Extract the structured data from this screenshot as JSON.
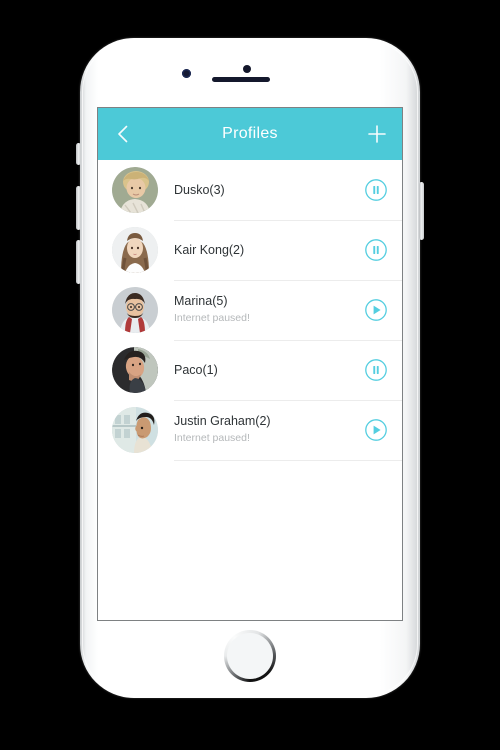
{
  "device": {
    "name": "white-smartphone",
    "hardware": {
      "earpiece_speaker": "speaker-slot",
      "front_camera": "front-camera-icon",
      "proximity_sensor": "proximity-sensor-icon",
      "home_button": "home-button",
      "side_buttons": [
        "silent-switch",
        "volume-up-button",
        "volume-down-button",
        "power-button"
      ]
    }
  },
  "theme": {
    "accent": "#4cc9d7",
    "appbar_bg": "#4cc9d7",
    "appbar_text": "#ffffff",
    "screen_bg": "#ffffff",
    "divider": "#ececec",
    "name_color": "#2f3437",
    "subtitle_color": "#b5b8ba"
  },
  "appbar": {
    "title": "Profiles",
    "back_icon": "chevron-left-icon",
    "add_icon": "plus-icon"
  },
  "list": {
    "rows": [
      {
        "name": "Dusko(3)",
        "subtitle": "",
        "action": "pause",
        "avatar": "avatar-blond-child"
      },
      {
        "name": "Kair Kong(2)",
        "subtitle": "",
        "action": "pause",
        "avatar": "avatar-long-haired-woman"
      },
      {
        "name": "Marina(5)",
        "subtitle": "Internet paused!",
        "action": "play",
        "avatar": "avatar-bearded-man-glasses"
      },
      {
        "name": "Paco(1)",
        "subtitle": "",
        "action": "pause",
        "avatar": "avatar-person-hand-face"
      },
      {
        "name": "Justin Graham(2)",
        "subtitle": "Internet paused!",
        "action": "play",
        "avatar": "avatar-man-profile-building"
      }
    ]
  }
}
